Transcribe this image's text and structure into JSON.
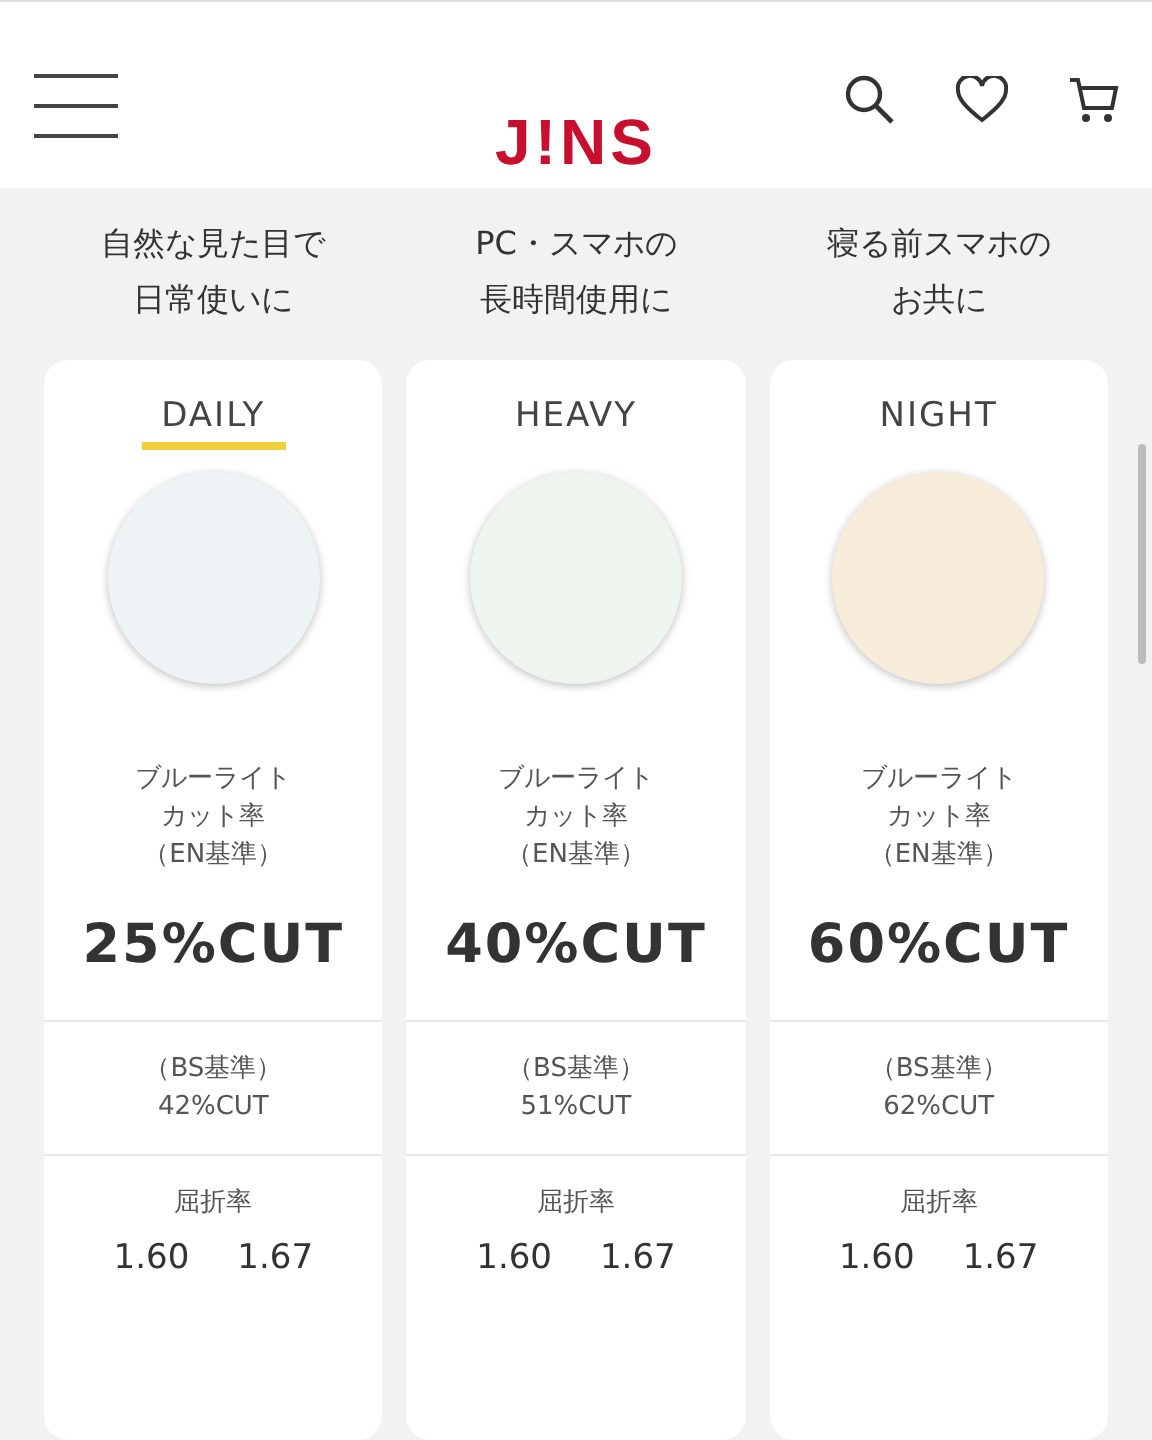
{
  "header": {
    "logo": "J!NS"
  },
  "lenses": [
    {
      "caption": [
        "自然な見た目で",
        "日常使いに"
      ],
      "name": "DAILY",
      "highlighted": true,
      "color": "#eef3f6",
      "cut_label": [
        "ブルーライト",
        "カット率",
        "（EN基準）"
      ],
      "cut": "25%CUT",
      "bs_label": "（BS基準）",
      "bs_cut": "42%CUT",
      "index_label": "屈折率",
      "indices": [
        "1.60",
        "1.67"
      ]
    },
    {
      "caption": [
        "PC・スマホの",
        "長時間使用に"
      ],
      "name": "HEAVY",
      "highlighted": false,
      "color": "#eef4ee",
      "cut_label": [
        "ブルーライト",
        "カット率",
        "（EN基準）"
      ],
      "cut": "40%CUT",
      "bs_label": "（BS基準）",
      "bs_cut": "51%CUT",
      "index_label": "屈折率",
      "indices": [
        "1.60",
        "1.67"
      ]
    },
    {
      "caption": [
        "寝る前スマホの",
        "お共に"
      ],
      "name": "NIGHT",
      "highlighted": false,
      "color": "#f7ecd9",
      "cut_label": [
        "ブルーライト",
        "カット率",
        "（EN基準）"
      ],
      "cut": "60%CUT",
      "bs_label": "（BS基準）",
      "bs_cut": "62%CUT",
      "index_label": "屈折率",
      "indices": [
        "1.60",
        "1.67"
      ]
    }
  ]
}
